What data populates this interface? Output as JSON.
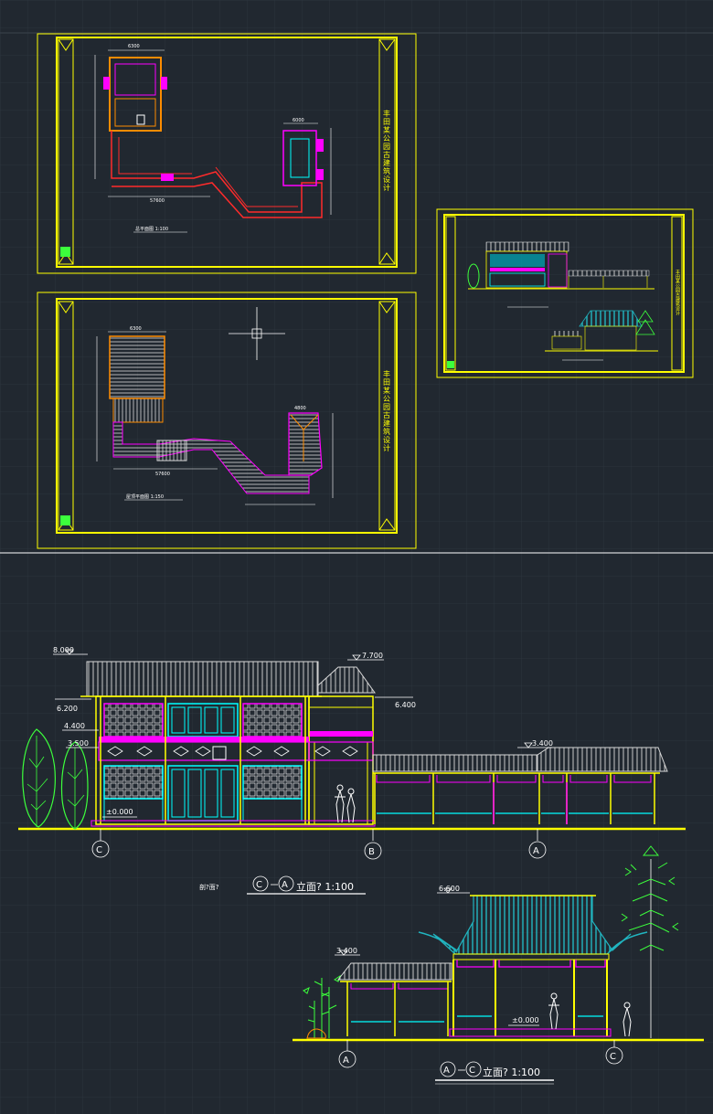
{
  "colors": {
    "background": "#212830",
    "grid": "#2c343d",
    "frame": "#ffff00",
    "wall": "#ffff00",
    "roof_main": "#d0d0d0",
    "roof_teal": "#21b5c0",
    "magenta": "#ff00ff",
    "cyan": "#00ffff",
    "tree": "#3cff3c",
    "red": "#ff2b2b",
    "text": "#ffffff"
  },
  "sheet1": {
    "plan_caption": "总平面图 1:100",
    "title_block": "丰田某公园古建筑设计",
    "dims": {
      "top_width": "6300",
      "bottom_total": "57600",
      "right_block": "6000"
    }
  },
  "sheet2": {
    "plan_caption": "屋顶平面图 1:150",
    "title_block": "丰田某公园古建筑设计",
    "dims": {
      "top_width": "6300",
      "bottom_total": "57600",
      "right_block": "4800"
    }
  },
  "sheet3": {
    "caption_top": "C-A立面 1:100",
    "caption_bottom": "A-C立面 1:100",
    "title_block": "丰田某公园古建筑设计"
  },
  "elevation_ca": {
    "levels": {
      "ridge": "8.000",
      "eave": "6.200",
      "balcony": "4.400",
      "lintel": "3.500",
      "ground": "±0.000",
      "gable_top": "7.700",
      "gable_eave": "6.400",
      "corridor": "3.400"
    },
    "axes": [
      "C",
      "B",
      "A"
    ],
    "caption_prefix": "剖?面?",
    "caption_axis_left": "C",
    "caption_axis_right": "A",
    "caption_text": "立面? 1:100"
  },
  "elevation_ac": {
    "levels": {
      "pavilion_top": "6.600",
      "corridor": "3.400",
      "ground": "±0.000"
    },
    "axes": [
      "A",
      "C"
    ],
    "caption_axis_left": "A",
    "caption_axis_right": "C",
    "caption_text": "立面? 1:100"
  }
}
